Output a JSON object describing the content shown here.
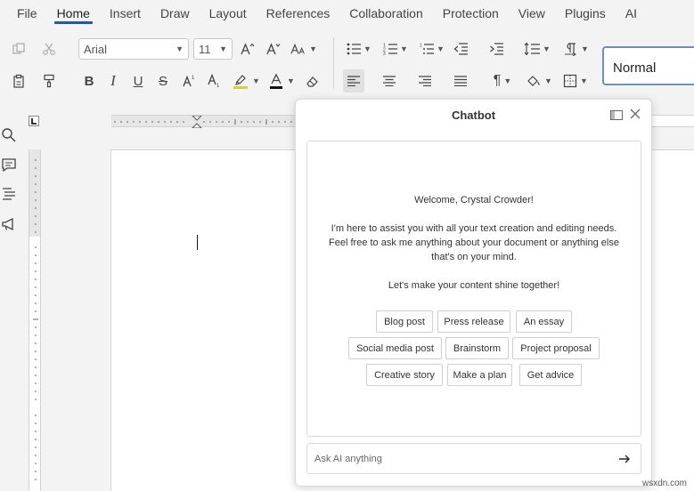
{
  "menu": {
    "items": [
      "File",
      "Home",
      "Insert",
      "Draw",
      "Layout",
      "References",
      "Collaboration",
      "Protection",
      "View",
      "Plugins",
      "AI"
    ],
    "active": "Home"
  },
  "toolbar": {
    "font_name": "Arial",
    "font_size": "11",
    "style": "Normal"
  },
  "chatbot": {
    "title": "Chatbot",
    "welcome": "Welcome, Crystal Crowder!",
    "intro_lines": [
      "I'm here to assist you with all your text creation and editing needs.",
      "Feel free to ask me anything about your document or anything else",
      "that's on your mind."
    ],
    "closing": "Let's make your content shine together!",
    "suggestions": [
      [
        "Blog post",
        "Press release",
        "An essay"
      ],
      [
        "Social media post",
        "Brainstorm",
        "Project proposal"
      ],
      [
        "Creative story",
        "Make a plan",
        "Get advice"
      ]
    ],
    "input_placeholder": "Ask AI anything"
  },
  "watermark": "wsxdn.com"
}
